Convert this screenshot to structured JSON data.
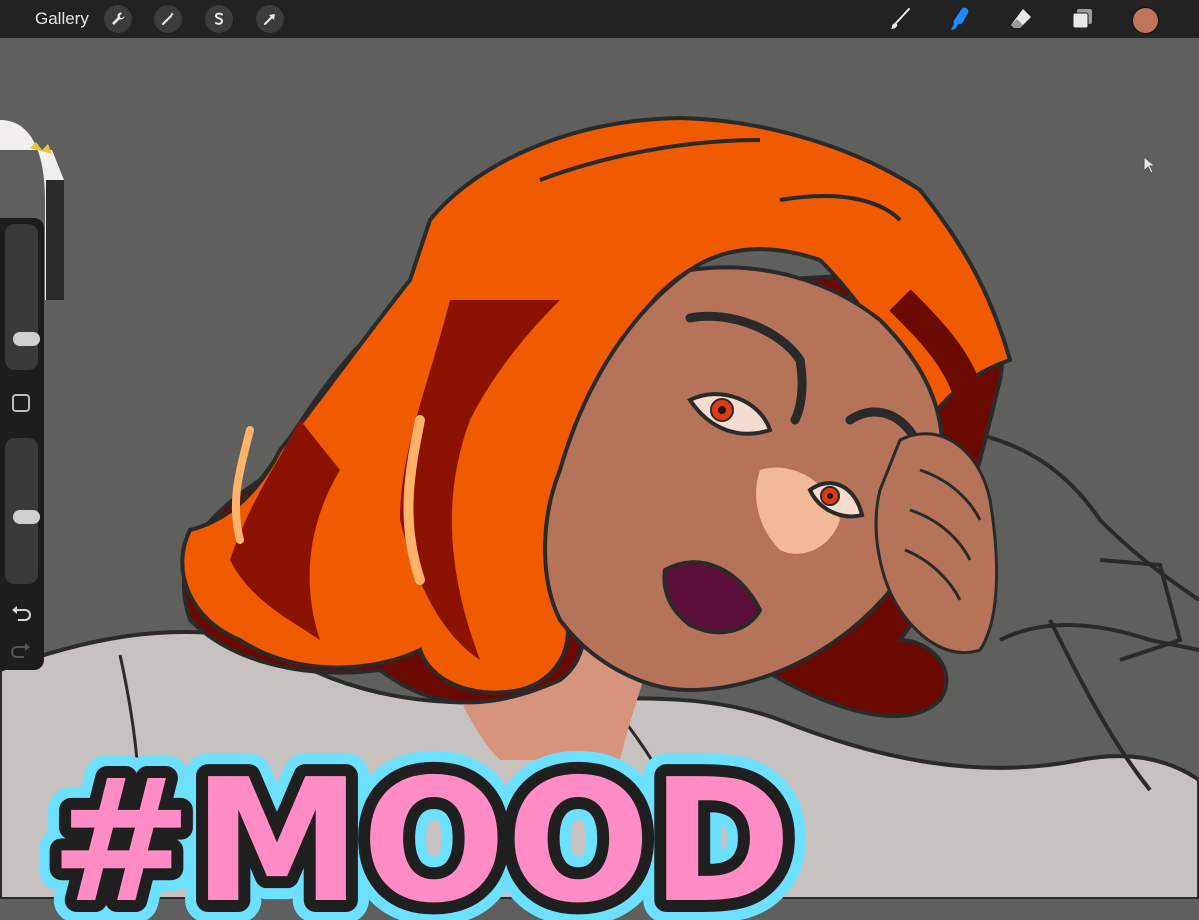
{
  "toolbar": {
    "gallery_label": "Gallery",
    "left_tools": [
      "wrench-icon",
      "magic-wand-icon",
      "selection-icon",
      "transform-arrow-icon"
    ],
    "right_tools": [
      "brush-icon",
      "smudge-icon",
      "eraser-icon",
      "layers-icon"
    ],
    "active_tool": "smudge-icon",
    "active_tool_color": "#1e88ff",
    "current_color": "#c0735b"
  },
  "sidebar": {
    "brush_size_level": 0.15,
    "opacity_level": 0.45,
    "undo_icon": "undo-icon",
    "redo_icon": "redo-icon"
  },
  "artwork": {
    "overlay_text": "#MOOD",
    "text_fill": "#ff8cc4",
    "text_outline": "#1f1f1f",
    "text_glow": "#6ee0ff",
    "hair_color": "#f05a00",
    "skin_color": "#b5735a",
    "shirt_color": "#c7c1c0"
  }
}
